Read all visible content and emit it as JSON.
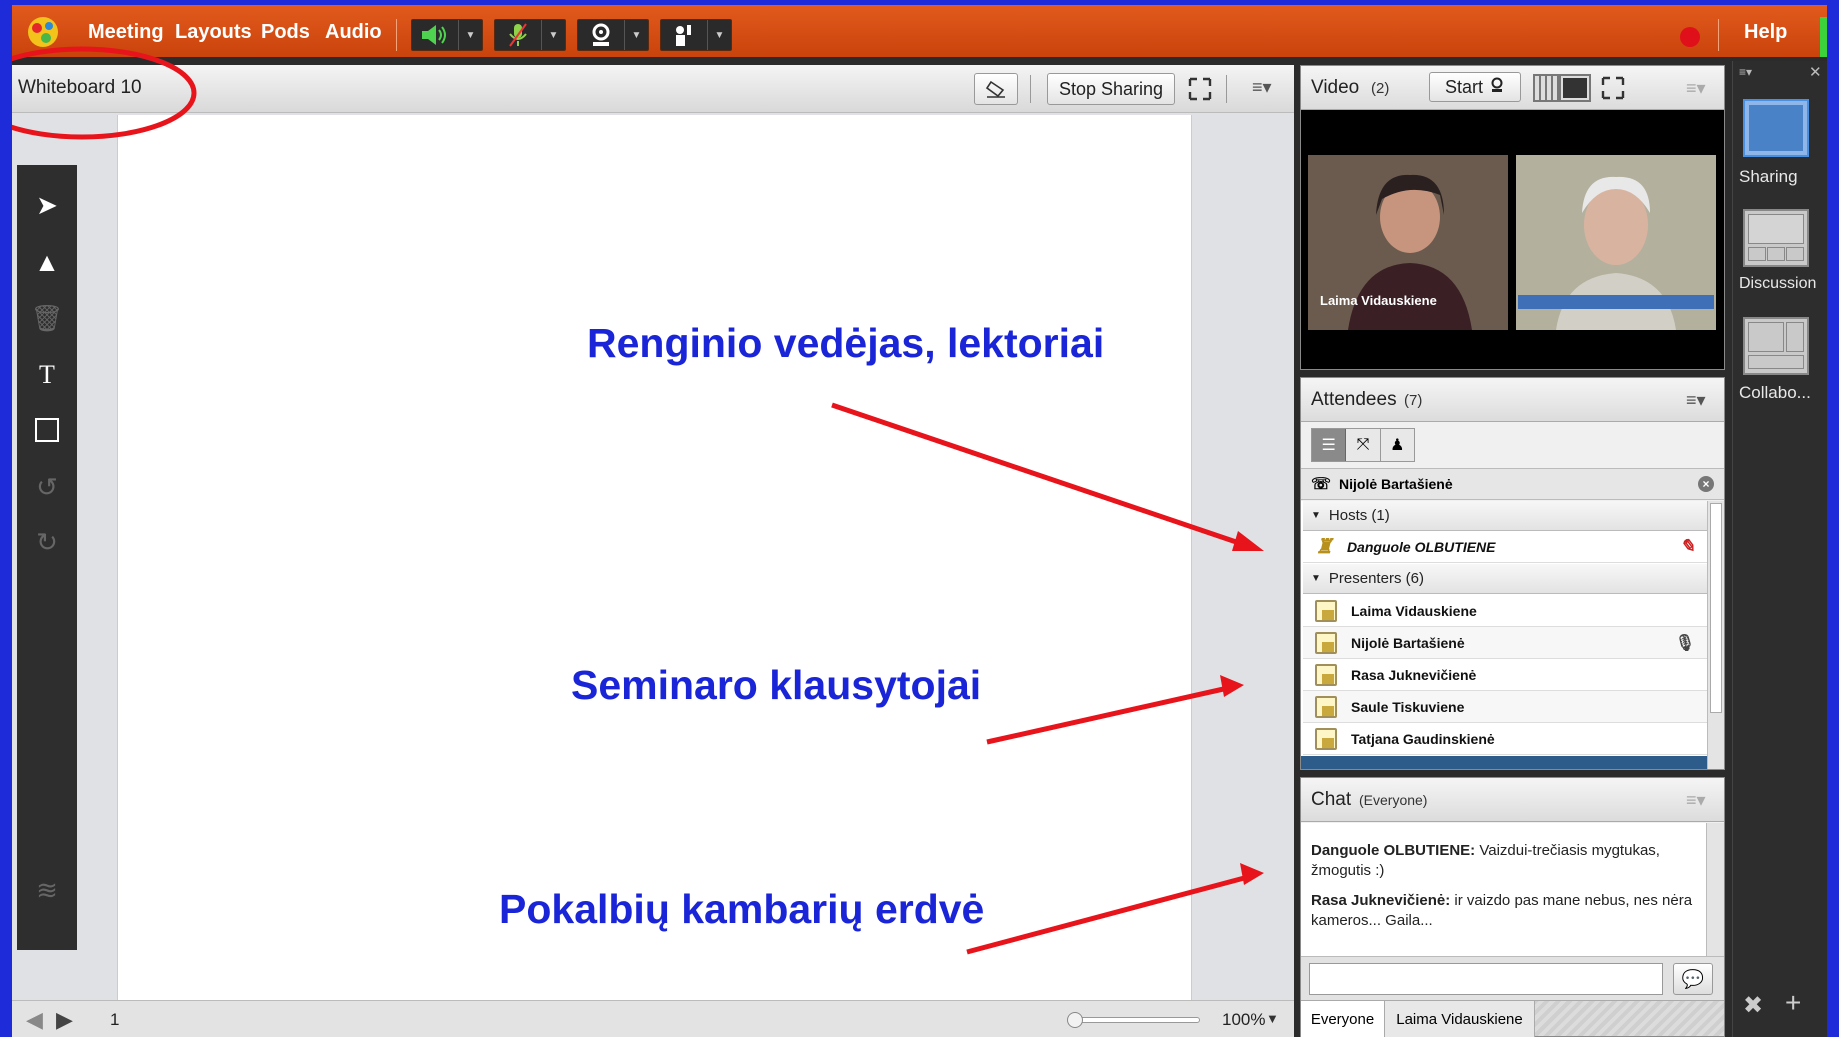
{
  "topbar": {
    "menus": [
      "Meeting",
      "Layouts",
      "Pods",
      "Audio"
    ],
    "help": "Help",
    "icons": [
      "speaker-icon",
      "microphone-icon",
      "webcam-icon",
      "raise-hand-icon"
    ]
  },
  "whiteboard": {
    "title": "Whiteboard 10",
    "stop_sharing": "Stop Sharing",
    "page_number": "1",
    "zoom": "100%",
    "tools": [
      "select-icon",
      "pencil-icon",
      "trash-icon",
      "text-icon",
      "rectangle-icon",
      "undo-icon",
      "redo-icon",
      "layers-icon"
    ]
  },
  "annotations": {
    "hosts": "Renginio vedėjas, lektoriai",
    "listeners": "Seminaro klausytojai",
    "chat_rooms": "Pokalbių kambarių erdvė"
  },
  "video": {
    "title": "Video",
    "count": "(2)",
    "start": "Start",
    "cam1_name": "Laima Vidauskiene"
  },
  "attendees": {
    "title": "Attendees",
    "count": "(7)",
    "speaking_now": "Nijolė Bartašienė",
    "hosts_label": "Hosts (1)",
    "host_name": "Danguole OLBUTIENE",
    "presenters_label": "Presenters (6)",
    "presenters": [
      "Laima Vidauskiene",
      "Nijolė Bartašienė",
      "Rasa Juknevičienė",
      "Saule Tiskuviene",
      "Tatjana Gaudinskienė"
    ]
  },
  "chat": {
    "title": "Chat",
    "scope": "(Everyone)",
    "messages": [
      {
        "author": "Danguole OLBUTIENE:",
        "text": " Vaizdui-trečiasis mygtukas, žmogutis  :)"
      },
      {
        "author": "Rasa Juknevičienė:",
        "text": " ir vaizdo pas mane nebus, nes nėra kameros... Gaila..."
      }
    ],
    "tabs": [
      "Everyone",
      "Laima Vidauskiene"
    ]
  },
  "layouts": {
    "items": [
      "Sharing",
      "Discussion",
      "Collabo..."
    ]
  },
  "colors": {
    "topbar": "#d9501a",
    "annotation_text": "#1a25d8",
    "arrow": "#e8141c",
    "frame": "#1d2bd8"
  }
}
